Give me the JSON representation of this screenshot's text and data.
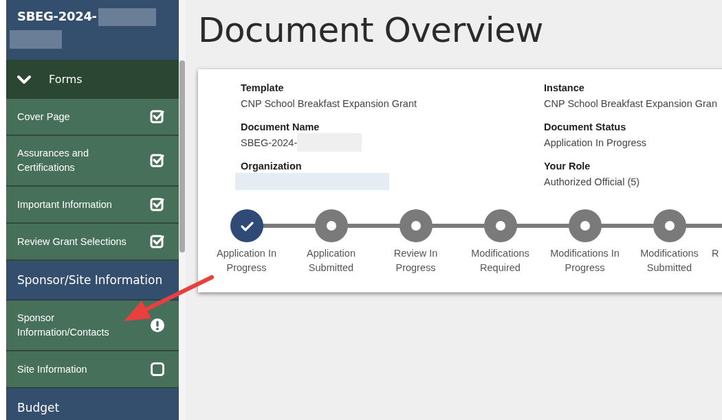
{
  "sidebar": {
    "title": {
      "text": "SBEG-2024-",
      "redacted": true
    },
    "groups": [
      {
        "kind": "collapsible",
        "label": "Forms",
        "expanded": true,
        "items": [
          {
            "label": "Cover Page",
            "kind": "checked"
          },
          {
            "label": "Assurances and Certifications",
            "kind": "checked"
          },
          {
            "label": "Important Information",
            "kind": "checked"
          },
          {
            "label": "Review Grant Selections",
            "kind": "checked"
          }
        ]
      },
      {
        "kind": "section",
        "label": "Sponsor/Site Information",
        "items": [
          {
            "label": "Sponsor Information/Contacts",
            "kind": "warning"
          },
          {
            "label": "Site Information",
            "kind": "unchecked"
          }
        ]
      },
      {
        "kind": "section",
        "label": "Budget"
      }
    ]
  },
  "page": {
    "title": "Document Overview",
    "fields": [
      {
        "label": "Template",
        "value": "CNP School Breakfast Expansion Grant"
      },
      {
        "label": "Instance",
        "value": "CNP School Breakfast Expansion Gran"
      },
      {
        "label": "Document Name",
        "value": "SBEG-2024-",
        "redacted": true
      },
      {
        "label": "Document Status",
        "value": "Application In Progress"
      },
      {
        "label": "Organization",
        "redacted": true
      },
      {
        "label": "Your Role",
        "value": "Authorized Official (5)"
      }
    ],
    "steps": [
      {
        "label": "Application In Progress",
        "done": true
      },
      {
        "label": "Application Submitted",
        "done": false
      },
      {
        "label": "Review In Progress",
        "done": false
      },
      {
        "label": "Modifications Required",
        "done": false
      },
      {
        "label": "Modifications In Progress",
        "done": false
      },
      {
        "label": "Modifications Submitted",
        "done": false
      },
      {
        "label": "R",
        "kind": "cut"
      }
    ]
  },
  "annotation": {
    "kind": "arrow"
  }
}
